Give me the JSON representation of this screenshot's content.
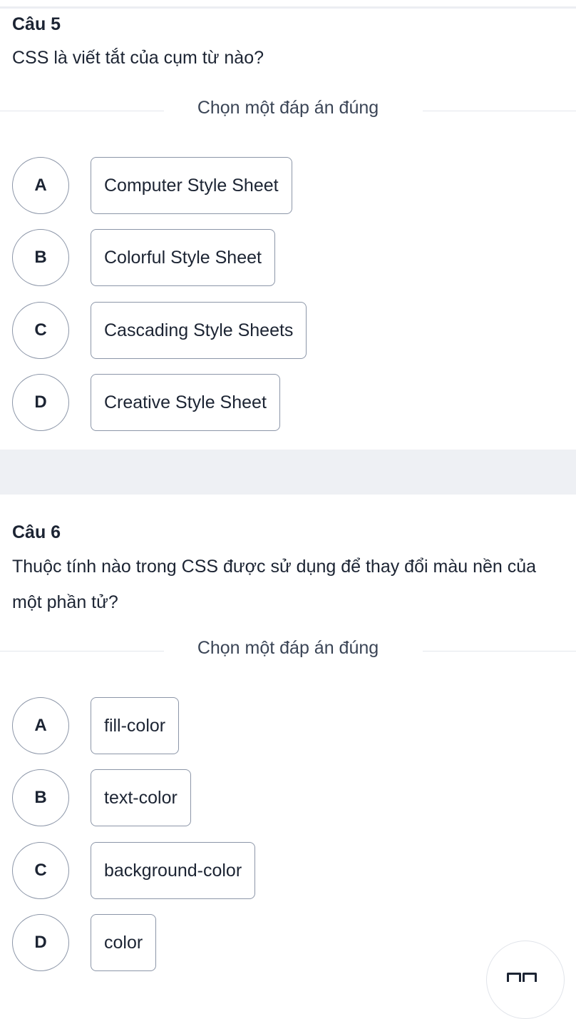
{
  "questions": [
    {
      "title": "Câu 5",
      "text": "CSS là viết tắt của cụm từ nào?",
      "instruction": "Chọn một đáp án đúng",
      "options": [
        {
          "letter": "A",
          "label": "Computer Style Sheet"
        },
        {
          "letter": "B",
          "label": "Colorful Style Sheet"
        },
        {
          "letter": "C",
          "label": "Cascading Style Sheets"
        },
        {
          "letter": "D",
          "label": "Creative Style Sheet"
        }
      ]
    },
    {
      "title": "Câu 6",
      "text": "Thuộc tính nào trong CSS được sử dụng để thay đổi màu nền của một phần tử?",
      "instruction": "Chọn một đáp án đúng",
      "options": [
        {
          "letter": "A",
          "label": "fill-color"
        },
        {
          "letter": "B",
          "label": "text-color"
        },
        {
          "letter": "C",
          "label": "background-color"
        },
        {
          "letter": "D",
          "label": "color"
        }
      ]
    }
  ],
  "floating_button": {
    "icon": "grid-menu-icon"
  },
  "colors": {
    "text": "#1c2433",
    "border": "#8c96a8",
    "separator_band": "#eef0f4"
  }
}
